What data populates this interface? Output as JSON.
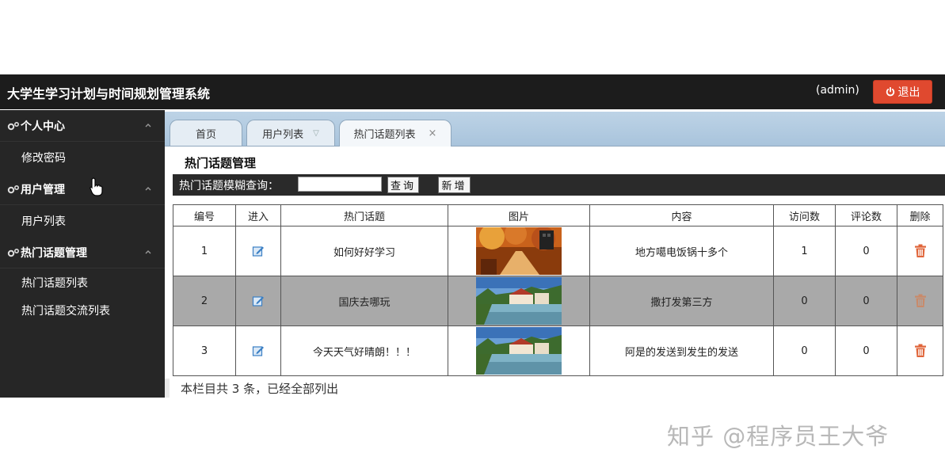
{
  "header": {
    "title": "大学生学习计划与时间规划管理系统",
    "user": "(admin)",
    "logout_label": "退出"
  },
  "sidebar": {
    "groups": [
      {
        "label": "个人中心",
        "items": [
          {
            "label": "修改密码"
          }
        ]
      },
      {
        "label": "用户管理",
        "items": [
          {
            "label": "用户列表"
          }
        ]
      },
      {
        "label": "热门话题管理",
        "items": [
          {
            "label": "热门话题列表"
          },
          {
            "label": "热门话题交流列表"
          }
        ]
      }
    ]
  },
  "tabs": [
    {
      "label": "首页"
    },
    {
      "label": "用户列表"
    },
    {
      "label": "热门话题列表",
      "close": "×"
    }
  ],
  "main": {
    "section_title": "热门话题管理",
    "search_label": "热门话题模糊查询：",
    "search_value": "",
    "query_button": "查询",
    "add_button": "新增",
    "columns": [
      "编号",
      "进入",
      "热门话题",
      "图片",
      "内容",
      "访问数",
      "评论数",
      "删除"
    ],
    "rows": [
      {
        "id": "1",
        "topic": "如何好好学习",
        "image": "autumn-path",
        "content": "地方噶电饭锅十多个",
        "visits": "1",
        "comments": "0"
      },
      {
        "id": "2",
        "topic": "国庆去哪玩",
        "image": "riverside-town",
        "content": "撒打发第三方",
        "visits": "0",
        "comments": "0"
      },
      {
        "id": "3",
        "topic": "今天天气好晴朗！！！",
        "image": "riverside-town",
        "content": "阿是的发送到发生的发送",
        "visits": "0",
        "comments": "0"
      }
    ],
    "footer_note": "本栏目共 3 条，已经全部列出"
  },
  "watermark": "知乎 @程序员王大爷",
  "colors": {
    "topbar": "#1c1c1c",
    "logout": "#e0492f",
    "sidebar": "#262626",
    "delete_icon": "#e0653a",
    "edit_icon": "#3a7fc4"
  }
}
